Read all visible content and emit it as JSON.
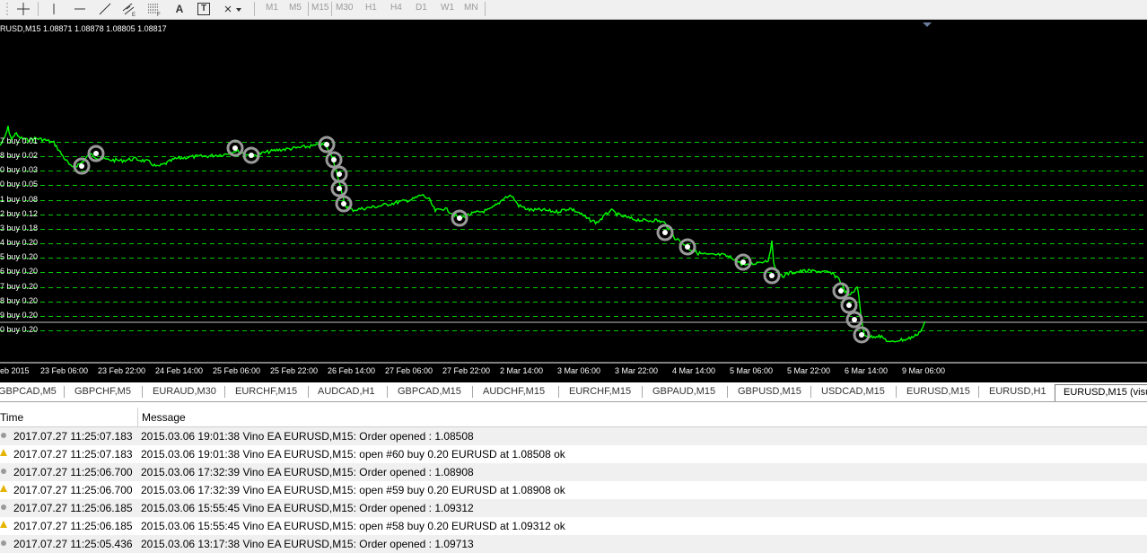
{
  "toolbar": {
    "tools": [
      "crosshair-icon",
      "vertical-line-icon",
      "horizontal-line-icon",
      "trendline-icon",
      "equidistant-channel-icon",
      "fibonacci-icon",
      "text-icon",
      "text-label-icon",
      "arrows-icon"
    ],
    "text_tool_glyph": "A",
    "label_tool_glyph": "T",
    "timeframes": [
      "M1",
      "M5",
      "M15",
      "M30",
      "H1",
      "H4",
      "D1",
      "W1",
      "MN"
    ]
  },
  "chart": {
    "symbol_line": "RUSD,M15  1.08871 1.08878 1.08805 1.08817",
    "colors": {
      "background": "#000000",
      "price_line": "#00ff00",
      "order_level": "#00cc00"
    },
    "order_levels": [
      "7 buy 0.01",
      "8 buy 0.02",
      "0 buy 0.03",
      "0 buy 0.05",
      "1 buy 0.08",
      "2 buy 0.12",
      "3 buy 0.18",
      "4 buy 0.20",
      "5 buy 0.20",
      "6 buy 0.20",
      "7 buy 0.20",
      "8 buy 0.20",
      "9 buy 0.20",
      "0 buy 0.20"
    ],
    "time_axis": [
      "eb 2015",
      "23 Feb 06:00",
      "23 Feb 22:00",
      "24 Feb 14:00",
      "25 Feb 06:00",
      "25 Feb 22:00",
      "26 Feb 14:00",
      "27 Feb 06:00",
      "27 Feb 22:00",
      "2 Mar 14:00",
      "3 Mar 06:00",
      "3 Mar 22:00",
      "4 Mar 14:00",
      "5 Mar 06:00",
      "5 Mar 22:00",
      "6 Mar 14:00",
      "9 Mar 06:00"
    ]
  },
  "tabs": [
    {
      "label": "GBPCAD,M5",
      "active": false
    },
    {
      "label": "GBPCHF,M5",
      "active": false
    },
    {
      "label": "EURAUD,M30",
      "active": false
    },
    {
      "label": "EURCHF,M15",
      "active": false
    },
    {
      "label": "AUDCAD,H1",
      "active": false
    },
    {
      "label": "GBPCAD,M15",
      "active": false
    },
    {
      "label": "AUDCHF,M15",
      "active": false
    },
    {
      "label": "EURCHF,M15",
      "active": false
    },
    {
      "label": "GBPAUD,M15",
      "active": false
    },
    {
      "label": "GBPUSD,M15",
      "active": false
    },
    {
      "label": "USDCAD,M15",
      "active": false
    },
    {
      "label": "EURUSD,M15",
      "active": false
    },
    {
      "label": "EURUSD,H1",
      "active": false
    },
    {
      "label": "EURUSD,M15 (visu",
      "active": true
    }
  ],
  "log": {
    "columns": {
      "time": "Time",
      "message": "Message"
    },
    "rows": [
      {
        "icon": "info-dot-icon",
        "time": "2017.07.27 11:25:07.183",
        "message": "2015.03.06 19:01:38  Vino EA EURUSD,M15: Order opened : 1.08508"
      },
      {
        "icon": "warning-icon",
        "time": "2017.07.27 11:25:07.183",
        "message": "2015.03.06 19:01:38  Vino EA EURUSD,M15: open #60 buy 0.20 EURUSD at 1.08508 ok"
      },
      {
        "icon": "info-dot-icon",
        "time": "2017.07.27 11:25:06.700",
        "message": "2015.03.06 17:32:39  Vino EA EURUSD,M15: Order opened : 1.08908"
      },
      {
        "icon": "warning-icon",
        "time": "2017.07.27 11:25:06.700",
        "message": "2015.03.06 17:32:39  Vino EA EURUSD,M15: open #59 buy 0.20 EURUSD at 1.08908 ok"
      },
      {
        "icon": "info-dot-icon",
        "time": "2017.07.27 11:25:06.185",
        "message": "2015.03.06 15:55:45  Vino EA EURUSD,M15: Order opened : 1.09312"
      },
      {
        "icon": "warning-icon",
        "time": "2017.07.27 11:25:06.185",
        "message": "2015.03.06 15:55:45  Vino EA EURUSD,M15: open #58 buy 0.20 EURUSD at 1.09312 ok"
      },
      {
        "icon": "info-dot-icon",
        "time": "2017.07.27 11:25:05.436",
        "message": "2015.03.06 13:17:38  Vino EA EURUSD,M15: Order opened : 1.09713"
      }
    ]
  }
}
